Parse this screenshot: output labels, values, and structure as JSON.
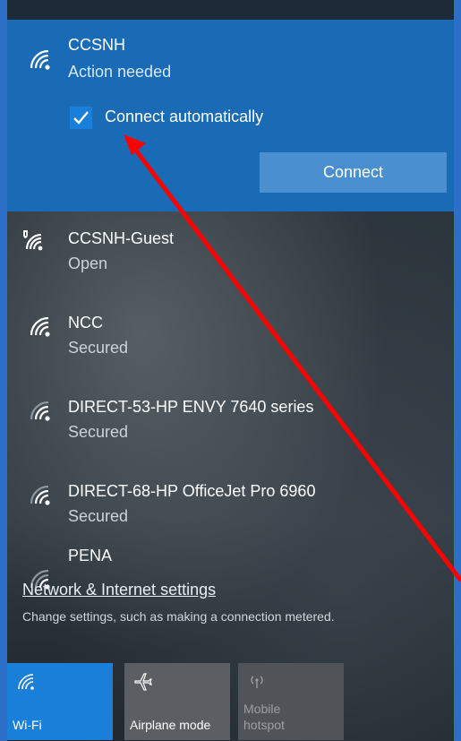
{
  "selected": {
    "name": "CCSNH",
    "status": "Action needed",
    "connect_automatically_label": "Connect automatically",
    "connect_automatically_checked": true,
    "connect_button_label": "Connect"
  },
  "networks": [
    {
      "name": "CCSNH-Guest",
      "status": "Open",
      "icon": "wifi-shield-icon"
    },
    {
      "name": "NCC",
      "status": "Secured",
      "icon": "wifi-icon"
    },
    {
      "name": "DIRECT-53-HP ENVY 7640 series",
      "status": "Secured",
      "icon": "wifi-icon"
    },
    {
      "name": "DIRECT-68-HP OfficeJet Pro 6960",
      "status": "Secured",
      "icon": "wifi-icon"
    },
    {
      "name": "PENA",
      "status": "",
      "icon": "wifi-icon"
    }
  ],
  "settings": {
    "link_label": "Network & Internet settings",
    "description": "Change settings, such as making a connection metered."
  },
  "tiles": [
    {
      "label": "Wi-Fi",
      "icon": "wifi-icon",
      "active": true,
      "color": "#1a7fd8"
    },
    {
      "label": "Airplane mode",
      "icon": "airplane-icon",
      "active": false,
      "color": "#5b5f63"
    },
    {
      "label": "Mobile hotspot",
      "line1": "Mobile",
      "line2": "hotspot",
      "icon": "hotspot-icon",
      "active": false,
      "disabled": true,
      "color": "#505458"
    }
  ],
  "annotation": {
    "arrow_color": "#ff0000"
  }
}
